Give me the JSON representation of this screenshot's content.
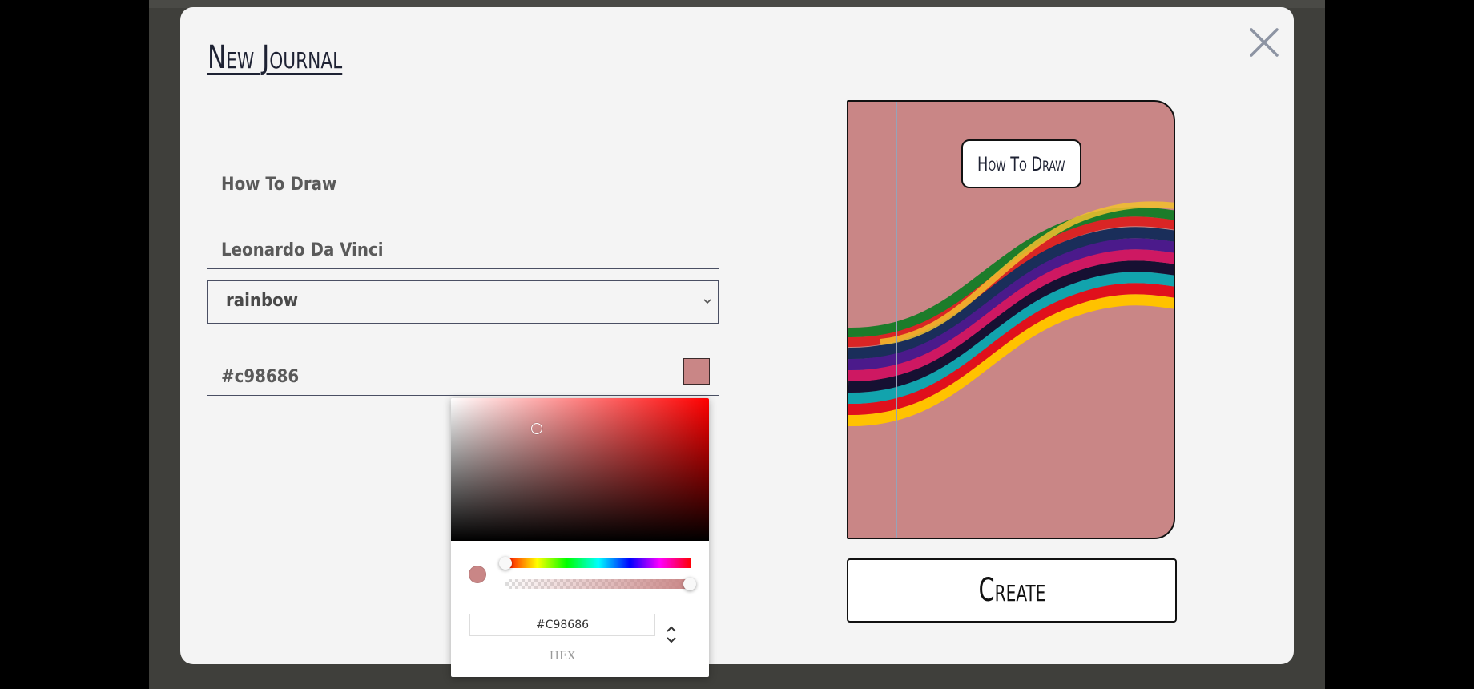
{
  "modal": {
    "title": "New Journal",
    "close_icon": "close-icon"
  },
  "form": {
    "title_value": "How To Draw",
    "author_value": "Leonardo Da Vinci",
    "pattern_selected": "rainbow",
    "color_value": "#c98686"
  },
  "color_picker": {
    "hex_value": "#C98686",
    "mode_label": "HEX",
    "hue_level": 0.0,
    "alpha_level": 1.0,
    "toggle_icon": "up-down-chevron-icon"
  },
  "preview": {
    "cover_color": "#c98686",
    "label_text": "How To Draw",
    "pattern": "rainbow"
  },
  "actions": {
    "create_label": "Create"
  }
}
